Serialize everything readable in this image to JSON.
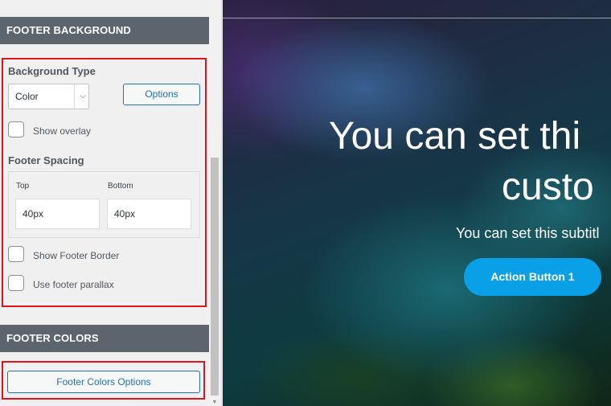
{
  "sections": {
    "footer_background": {
      "title": "FOOTER BACKGROUND",
      "background_type_label": "Background Type",
      "background_type_value": "Color",
      "options_button": "Options",
      "show_overlay_label": "Show overlay",
      "footer_spacing_label": "Footer Spacing",
      "spacing": {
        "top_label": "Top",
        "top_value": "40px",
        "bottom_label": "Bottom",
        "bottom_value": "40px"
      },
      "show_footer_border_label": "Show Footer Border",
      "use_footer_parallax_label": "Use footer parallax"
    },
    "footer_colors": {
      "title": "FOOTER COLORS",
      "options_button": "Footer Colors Options"
    }
  },
  "preview": {
    "headline_line1": "You can set thi",
    "headline_line2": "custo",
    "subtitle": "You can set this subtitl",
    "action_button": "Action Button 1"
  },
  "icons": {
    "select_chevron": "chevron-down-icon",
    "scroll_down": "scroll-down-arrow-icon"
  },
  "colors": {
    "section_header_bg": "#5c656d",
    "highlight_border": "#e0141e",
    "button_accent": "#2271b1",
    "action_button_bg": "#0aa0e8"
  }
}
